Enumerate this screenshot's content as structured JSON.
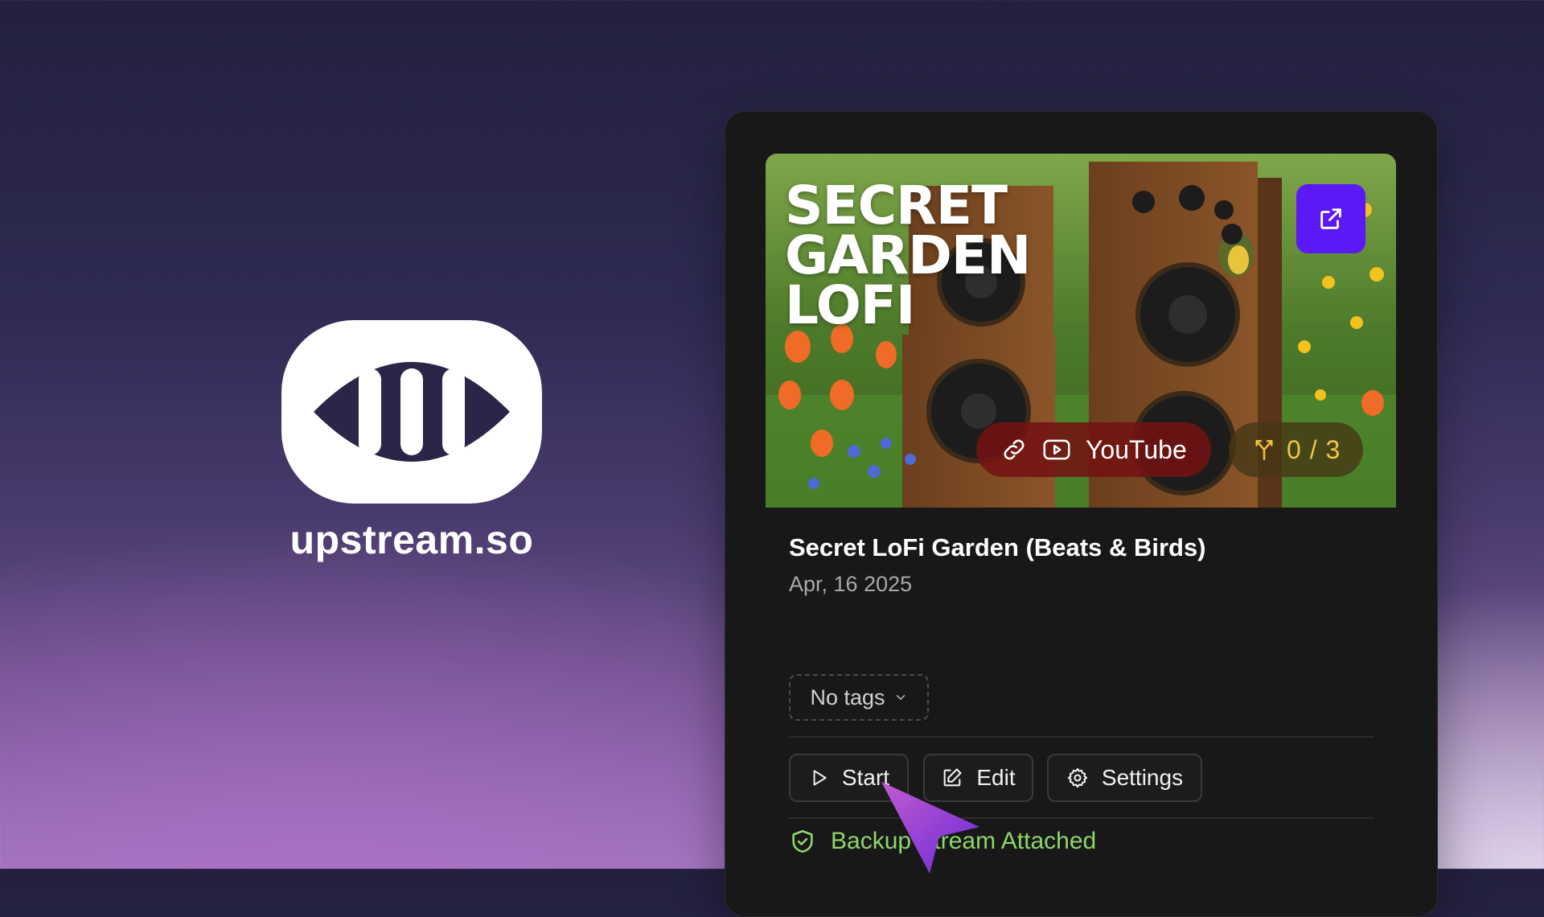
{
  "brand": {
    "name": "upstream.so"
  },
  "card": {
    "thumbnail_title": "SECRET GARDEN LOFI",
    "platform": {
      "label": "YouTube",
      "color": "#7a1212"
    },
    "forks": {
      "label": "0 / 3",
      "color": "#f5c542"
    },
    "open_button_color": "#5a19f5",
    "stream_title": "Secret LoFi Garden (Beats & Birds)",
    "date": "Apr, 16 2025",
    "tags_label": "No tags",
    "actions": {
      "start": "Start",
      "edit": "Edit",
      "settings": "Settings"
    },
    "backup_status": "Backup Stream Attached",
    "backup_color": "#8ed66b"
  }
}
